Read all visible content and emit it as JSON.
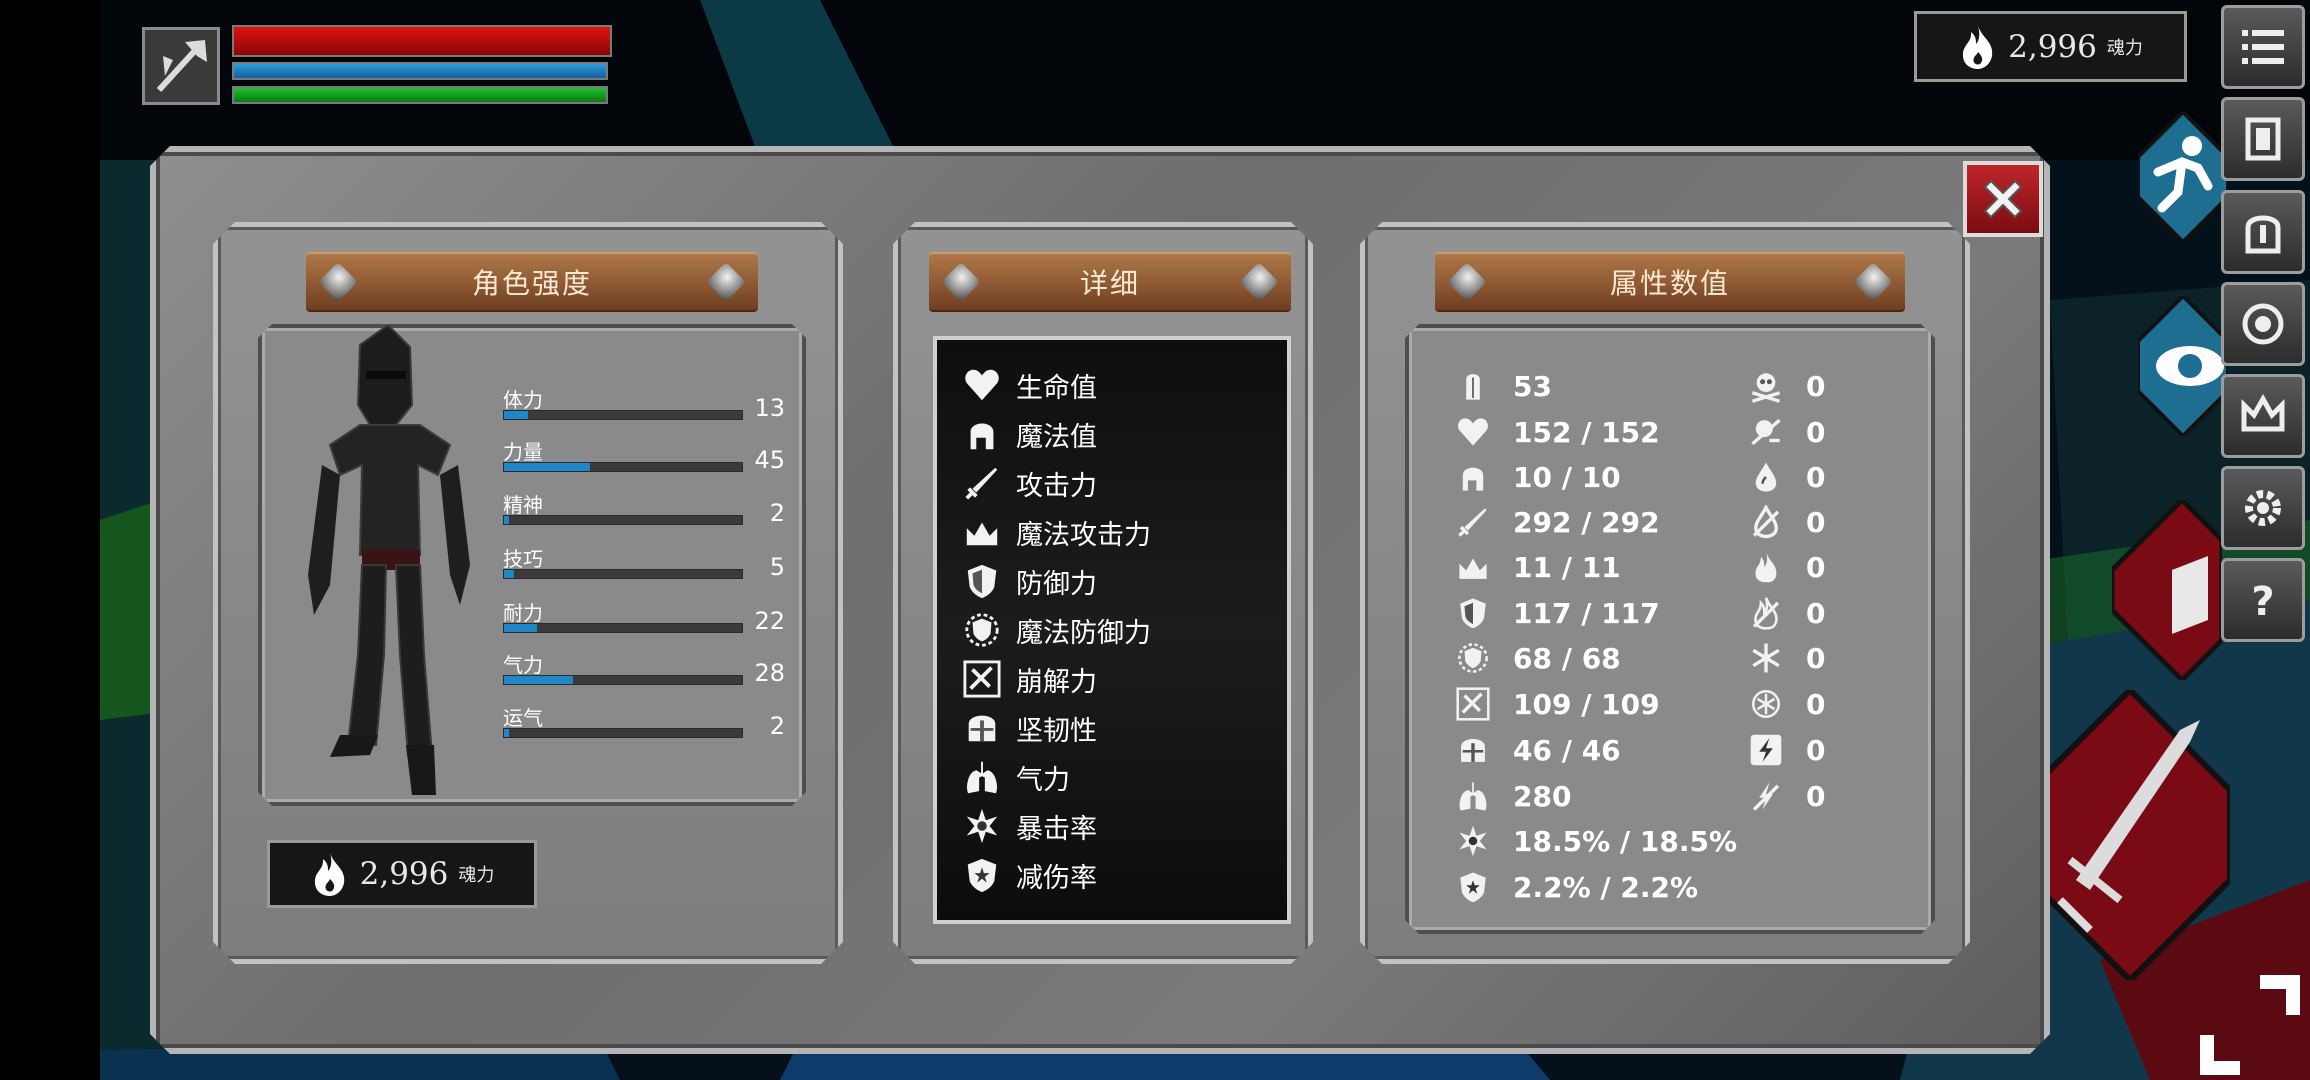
{
  "currency": {
    "amount": "2,996",
    "unit": "魂力"
  },
  "panels": {
    "character": {
      "title": "角色强度"
    },
    "details": {
      "title": "详细"
    },
    "attributes": {
      "title": "属性数值"
    }
  },
  "character_attributes": [
    {
      "label": "体力",
      "value": "13",
      "fill": 0.1
    },
    {
      "label": "力量",
      "value": "45",
      "fill": 0.36
    },
    {
      "label": "精神",
      "value": "2",
      "fill": 0.02
    },
    {
      "label": "技巧",
      "value": "5",
      "fill": 0.04
    },
    {
      "label": "耐力",
      "value": "22",
      "fill": 0.14
    },
    {
      "label": "气力",
      "value": "28",
      "fill": 0.29
    },
    {
      "label": "运气",
      "value": "2",
      "fill": 0.02
    }
  ],
  "details": [
    {
      "label": "生命值",
      "icon": "heart-icon"
    },
    {
      "label": "魔法值",
      "icon": "head-icon"
    },
    {
      "label": "攻击力",
      "icon": "sword-icon"
    },
    {
      "label": "魔法攻击力",
      "icon": "crown-magic-icon"
    },
    {
      "label": "防御力",
      "icon": "shield-icon"
    },
    {
      "label": "魔法防御力",
      "icon": "magic-shield-icon"
    },
    {
      "label": "崩解力",
      "icon": "break-icon"
    },
    {
      "label": "坚韧性",
      "icon": "helmet-icon"
    },
    {
      "label": "气力",
      "icon": "lungs-icon"
    },
    {
      "label": "暴击率",
      "icon": "star-burst-icon"
    },
    {
      "label": "减伤率",
      "icon": "shield-star-icon"
    }
  ],
  "stats_left": [
    {
      "icon": "armor-icon",
      "value": "53"
    },
    {
      "icon": "heart-icon",
      "value": "152 / 152"
    },
    {
      "icon": "head-icon",
      "value": "10 / 10"
    },
    {
      "icon": "sword-icon",
      "value": "292 / 292"
    },
    {
      "icon": "crown-magic-icon",
      "value": "11 / 11"
    },
    {
      "icon": "shield-icon",
      "value": "117 / 117"
    },
    {
      "icon": "magic-shield-icon",
      "value": "68 / 68"
    },
    {
      "icon": "break-icon",
      "value": "109 / 109"
    },
    {
      "icon": "helmet-icon",
      "value": "46 / 46"
    },
    {
      "icon": "lungs-icon",
      "value": "280"
    },
    {
      "icon": "star-burst-icon",
      "value": "18.5% / 18.5%"
    },
    {
      "icon": "shield-star-icon",
      "value": "2.2% / 2.2%"
    }
  ],
  "stats_right": [
    {
      "icon": "skull-icon",
      "value": "0"
    },
    {
      "icon": "poison-resist-icon",
      "value": "0"
    },
    {
      "icon": "drop-icon",
      "value": "0"
    },
    {
      "icon": "drop-resist-icon",
      "value": "0"
    },
    {
      "icon": "fire-icon",
      "value": "0"
    },
    {
      "icon": "fire-resist-icon",
      "value": "0"
    },
    {
      "icon": "frost-icon",
      "value": "0"
    },
    {
      "icon": "frost-resist-icon",
      "value": "0"
    },
    {
      "icon": "lightning-icon",
      "value": "0"
    },
    {
      "icon": "lightning-resist-icon",
      "value": "0"
    }
  ],
  "menu": [
    "menu-icon",
    "inventory-icon",
    "equipment-icon",
    "skills-icon",
    "crown-icon",
    "settings-icon",
    "help-icon"
  ],
  "colors": {
    "hp": "#e01212",
    "mp": "#2d9ad8",
    "stamina": "#20c030",
    "attr_fill": "#1f86c8",
    "close": "#c0262a"
  }
}
